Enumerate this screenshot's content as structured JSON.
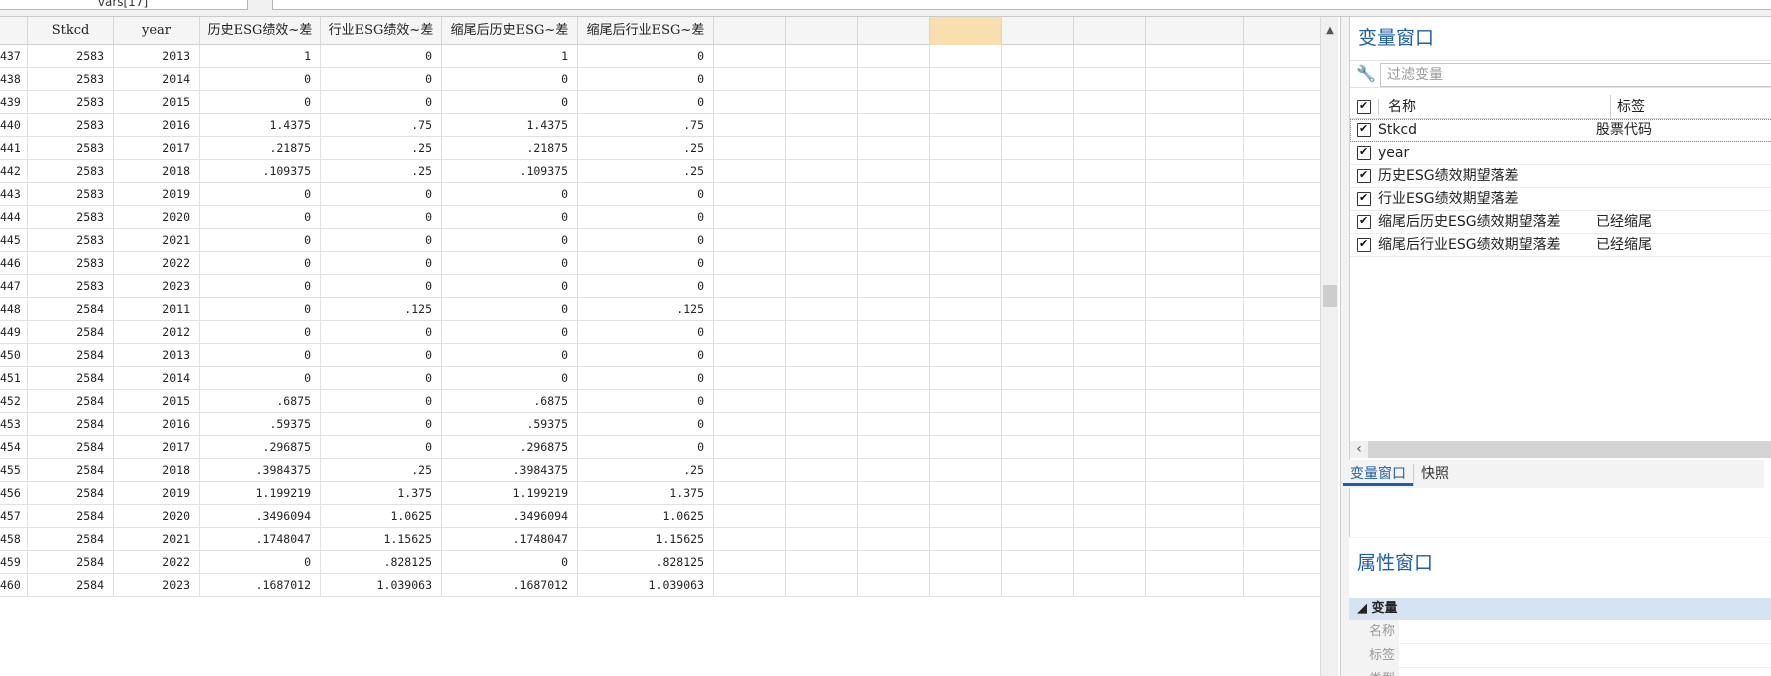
{
  "top": {
    "varlist_box": "vars[17]"
  },
  "grid": {
    "columns": [
      {
        "label": "",
        "width": 28
      },
      {
        "label": "Stkcd",
        "width": 86
      },
      {
        "label": "year",
        "width": 86
      },
      {
        "label": "历史ESG绩效~差",
        "width": 121
      },
      {
        "label": "行业ESG绩效~差",
        "width": 121
      },
      {
        "label": "缩尾后历史ESG~差",
        "width": 136
      },
      {
        "label": "缩尾后行业ESG~差",
        "width": 136
      },
      {
        "label": "",
        "width": 72
      },
      {
        "label": "",
        "width": 72
      },
      {
        "label": "",
        "width": 72
      },
      {
        "label": "",
        "width": 72
      },
      {
        "label": "",
        "width": 72
      },
      {
        "label": "",
        "width": 72
      },
      {
        "label": "",
        "width": 98
      }
    ],
    "rows": [
      [
        "437",
        "2583",
        "2013",
        "1",
        "0",
        "1",
        "0"
      ],
      [
        "438",
        "2583",
        "2014",
        "0",
        "0",
        "0",
        "0"
      ],
      [
        "439",
        "2583",
        "2015",
        "0",
        "0",
        "0",
        "0"
      ],
      [
        "440",
        "2583",
        "2016",
        "1.4375",
        ".75",
        "1.4375",
        ".75"
      ],
      [
        "441",
        "2583",
        "2017",
        ".21875",
        ".25",
        ".21875",
        ".25"
      ],
      [
        "442",
        "2583",
        "2018",
        ".109375",
        ".25",
        ".109375",
        ".25"
      ],
      [
        "443",
        "2583",
        "2019",
        "0",
        "0",
        "0",
        "0"
      ],
      [
        "444",
        "2583",
        "2020",
        "0",
        "0",
        "0",
        "0"
      ],
      [
        "445",
        "2583",
        "2021",
        "0",
        "0",
        "0",
        "0"
      ],
      [
        "446",
        "2583",
        "2022",
        "0",
        "0",
        "0",
        "0"
      ],
      [
        "447",
        "2583",
        "2023",
        "0",
        "0",
        "0",
        "0"
      ],
      [
        "448",
        "2584",
        "2011",
        "0",
        ".125",
        "0",
        ".125"
      ],
      [
        "449",
        "2584",
        "2012",
        "0",
        "0",
        "0",
        "0"
      ],
      [
        "450",
        "2584",
        "2013",
        "0",
        "0",
        "0",
        "0"
      ],
      [
        "451",
        "2584",
        "2014",
        "0",
        "0",
        "0",
        "0"
      ],
      [
        "452",
        "2584",
        "2015",
        ".6875",
        "0",
        ".6875",
        "0"
      ],
      [
        "453",
        "2584",
        "2016",
        ".59375",
        "0",
        ".59375",
        "0"
      ],
      [
        "454",
        "2584",
        "2017",
        ".296875",
        "0",
        ".296875",
        "0"
      ],
      [
        "455",
        "2584",
        "2018",
        ".3984375",
        ".25",
        ".3984375",
        ".25"
      ],
      [
        "456",
        "2584",
        "2019",
        "1.199219",
        "1.375",
        "1.199219",
        "1.375"
      ],
      [
        "457",
        "2584",
        "2020",
        ".3496094",
        "1.0625",
        ".3496094",
        "1.0625"
      ],
      [
        "458",
        "2584",
        "2021",
        ".1748047",
        "1.15625",
        ".1748047",
        "1.15625"
      ],
      [
        "459",
        "2584",
        "2022",
        "0",
        ".828125",
        "0",
        ".828125"
      ],
      [
        "460",
        "2584",
        "2023",
        ".1687012",
        "1.039063",
        ".1687012",
        "1.039063"
      ]
    ]
  },
  "var_window": {
    "title": "变量窗口",
    "filter_placeholder": "过滤变量",
    "col_name": "名称",
    "col_label": "标签",
    "variables": [
      {
        "name": "Stkcd",
        "label": "股票代码"
      },
      {
        "name": "year",
        "label": ""
      },
      {
        "name": "历史ESG绩效期望落差",
        "label": ""
      },
      {
        "name": "行业ESG绩效期望落差",
        "label": ""
      },
      {
        "name": "缩尾后历史ESG绩效期望落差",
        "label": "已经缩尾"
      },
      {
        "name": "缩尾后行业ESG绩效期望落差",
        "label": "已经缩尾"
      }
    ],
    "tabs": [
      "变量窗口",
      "快照"
    ]
  },
  "prop_window": {
    "title": "属性窗口",
    "group": "变量",
    "fields": [
      "名称",
      "标签",
      "类型"
    ]
  }
}
